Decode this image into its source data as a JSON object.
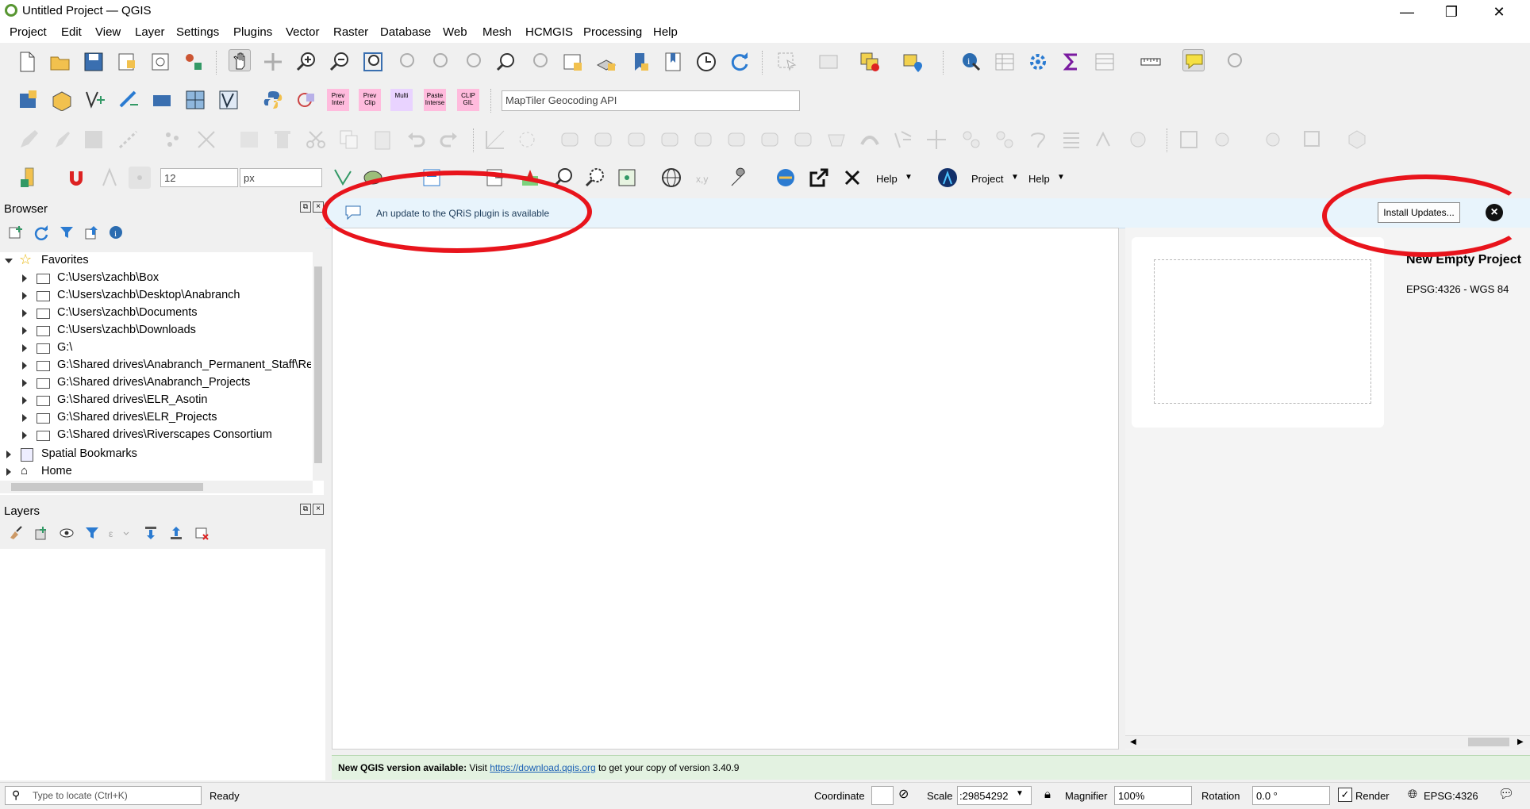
{
  "window": {
    "title": "Untitled Project — QGIS",
    "min": "—",
    "restore": "❐",
    "close": "✕"
  },
  "menu": [
    "Project",
    "Edit",
    "View",
    "Layer",
    "Settings",
    "Plugins",
    "Vector",
    "Raster",
    "Database",
    "Web",
    "Mesh",
    "HCMGIS",
    "Processing",
    "Help"
  ],
  "toolbar": {
    "geocoding_placeholder": "MapTiler Geocoding API",
    "size_value": "12",
    "unit_value": "px",
    "help_label": "Help",
    "project_label": "Project",
    "help2_label": "Help",
    "plugin_icons": [
      "Prev Inter",
      "Prev Clip",
      "Multi",
      "Paste Interse",
      "CLIP GIL"
    ]
  },
  "browser": {
    "title": "Browser",
    "favorites": "Favorites",
    "items": [
      "C:\\Users\\zachb\\Box",
      "C:\\Users\\zachb\\Desktop\\Anabranch",
      "C:\\Users\\zachb\\Documents",
      "C:\\Users\\zachb\\Downloads",
      "G:\\",
      "G:\\Shared drives\\Anabranch_Permanent_Staff\\Re",
      "G:\\Shared drives\\Anabranch_Projects",
      "G:\\Shared drives\\ELR_Asotin",
      "G:\\Shared drives\\ELR_Projects",
      "G:\\Shared drives\\Riverscapes Consortium"
    ],
    "spatial_bookmarks": "Spatial Bookmarks",
    "home": "Home"
  },
  "layers": {
    "title": "Layers"
  },
  "message_bar": {
    "text": "An update to the QRiS plugin is available",
    "button": "Install Updates..."
  },
  "welcome": {
    "project_name": "New Empty Project",
    "crs": "EPSG:4326 - WGS 84"
  },
  "update_bar": {
    "bold": "New QGIS version available:",
    "visit": "Visit",
    "link": "https://download.qgis.org",
    "rest": "to get your copy of version 3.40.9"
  },
  "status": {
    "locate_placeholder": "Type to locate (Ctrl+K)",
    "ready": "Ready",
    "coordinate_label": "Coordinate",
    "scale_label": "Scale",
    "scale_value": ":29854292",
    "magnifier_label": "Magnifier",
    "magnifier_value": "100%",
    "rotation_label": "Rotation",
    "rotation_value": "0.0 °",
    "render_label": "Render",
    "crs": "EPSG:4326"
  },
  "colors": {
    "accent": "#589632",
    "annotation": "#e8141c",
    "message_bg": "#e8f4fc",
    "update_bg": "#e3f2e1"
  }
}
